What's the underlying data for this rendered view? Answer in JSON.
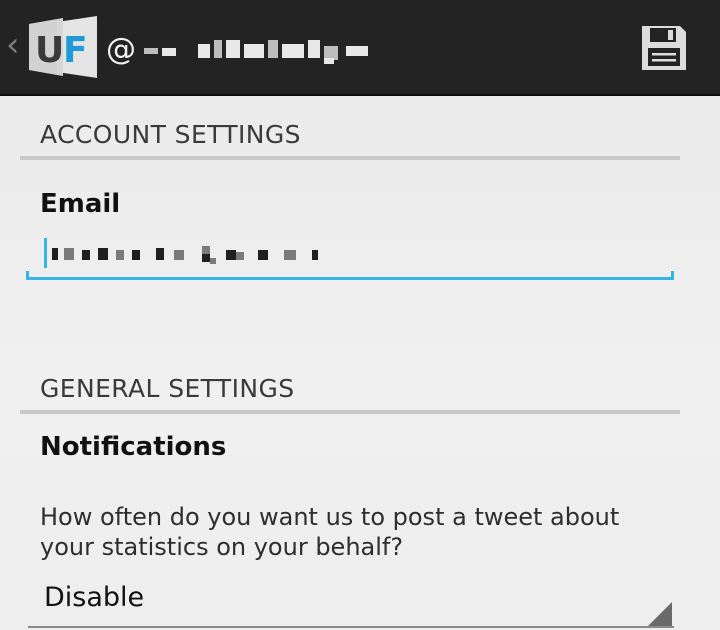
{
  "action_bar": {
    "up_caret": "‹",
    "logo_letters": [
      "U",
      "F"
    ],
    "handle_prefix": "@",
    "save_icon": "save-icon",
    "colors": {
      "background": "#232323",
      "accent": "#33b5e5"
    }
  },
  "account_settings": {
    "header": "ACCOUNT SETTINGS",
    "email_label": "Email"
  },
  "general_settings": {
    "header": "GENERAL SETTINGS",
    "notifications_label": "Notifications",
    "notifications_description": "How often do you want us to post a tweet about your statistics on your behalf?",
    "frequency_selected": "Disable"
  }
}
